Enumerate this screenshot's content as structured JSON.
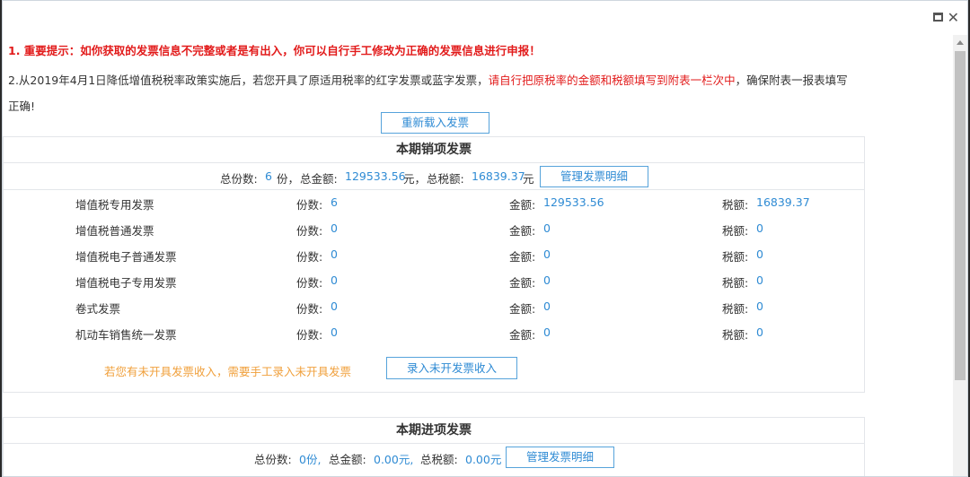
{
  "window": {
    "minimize_icon": "minimize-icon",
    "close_icon": "close-icon",
    "close_glyph": "✕"
  },
  "notice": {
    "line1": "1. 重要提示：如你获取的发票信息不完整或者是有出入，你可以自行手工修改为正确的发票信息进行申报！",
    "line2_prefix": "2.从2019年4月1日降低增值税税率政策实施后，若您开具了原适用税率的红字发票或蓝字发票，",
    "line2_highlight": "请自行把原税率的金额和税额填写到附表一栏次中",
    "line2_suffix": "，确保附表一报表填写正确!"
  },
  "reload_button": "重新载入发票",
  "sales": {
    "title": "本期销项发票",
    "summary": {
      "count_label": "总份数:",
      "count_value": "6",
      "count_unit": "份，",
      "amount_label": "总金额:",
      "amount_value": "129533.56",
      "amount_unit": "元，",
      "tax_label": "总税额:",
      "tax_value": "16839.37",
      "tax_unit": "元"
    },
    "manage_button": "管理发票明细",
    "rows": [
      {
        "name": "增值税专用发票",
        "count_label": "份数:",
        "count": "6",
        "amount_label": "金额:",
        "amount": "129533.56",
        "tax_label": "税额:",
        "tax": "16839.37"
      },
      {
        "name": "增值税普通发票",
        "count_label": "份数:",
        "count": "0",
        "amount_label": "金额:",
        "amount": "0",
        "tax_label": "税额:",
        "tax": "0"
      },
      {
        "name": "增值税电子普通发票",
        "count_label": "份数:",
        "count": "0",
        "amount_label": "金额:",
        "amount": "0",
        "tax_label": "税额:",
        "tax": "0"
      },
      {
        "name": "增值税电子专用发票",
        "count_label": "份数:",
        "count": "0",
        "amount_label": "金额:",
        "amount": "0",
        "tax_label": "税额:",
        "tax": "0"
      },
      {
        "name": "卷式发票",
        "count_label": "份数:",
        "count": "0",
        "amount_label": "金额:",
        "amount": "0",
        "tax_label": "税额:",
        "tax": "0"
      },
      {
        "name": "机动车销售统一发票",
        "count_label": "份数:",
        "count": "0",
        "amount_label": "金额:",
        "amount": "0",
        "tax_label": "税额:",
        "tax": "0"
      }
    ],
    "hint": "若您有未开具发票收入，需要手工录入未开具发票",
    "entry_button": "录入未开发票收入"
  },
  "purchase": {
    "title": "本期进项发票",
    "summary": {
      "count_label": "总份数:",
      "count_value": "0份,",
      "amount_label": "总金额:",
      "amount_value": "0.00元,",
      "tax_label": "总税额:",
      "tax_value": "0.00元"
    },
    "manage_button": "管理发票明细"
  }
}
